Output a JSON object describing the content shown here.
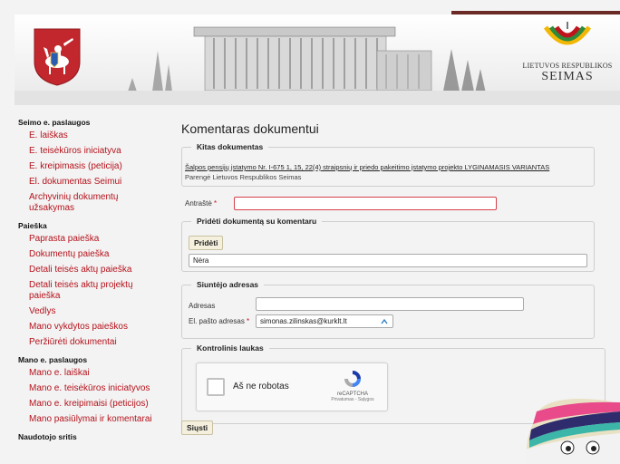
{
  "header": {
    "seimas_line1": "LIETUVOS RESPUBLIKOS",
    "seimas_line2": "SEIMAS"
  },
  "sidebar": {
    "sections": [
      {
        "title": "Seimo e. paslaugos",
        "items": [
          "E. laiškas",
          "E. teisėkūros iniciatyva",
          "E. kreipimasis (peticija)",
          "El. dokumentas Seimui",
          "Archyvinių dokumentų užsakymas"
        ]
      },
      {
        "title": "Paieška",
        "items": [
          "Paprasta paieška",
          "Dokumentų paieška",
          "Detali teisės aktų paieška",
          "Detali teisės aktų projektų paieška",
          "Vedlys",
          "Mano vykdytos paieškos",
          "Peržiūrėti dokumentai"
        ]
      },
      {
        "title": "Mano e. paslaugos",
        "items": [
          "Mano e. laiškai",
          "Mano e. teisėkūros iniciatyvos",
          "Mano e. kreipimaisi (peticijos)",
          "Mano pasiūlymai ir komentarai"
        ]
      },
      {
        "title": "Naudotojo sritis",
        "items": []
      }
    ]
  },
  "main": {
    "title": "Komentaras dokumentui",
    "other_docs": {
      "legend": "Kitas dokumentas",
      "link": "Šalpos pensijų įstatymo Nr. I-675 1, 15, 22(4) straipsnių ir priedo pakeitimo įstatymo projekto LYGINAMASIS VARIANTAS",
      "subtitle": "Parengė Lietuvos Respublikos Seimas"
    },
    "subject": {
      "label": "Antraštė",
      "required": "*",
      "value": ""
    },
    "attach": {
      "legend": "Pridėti dokumentą su komentaru",
      "button": "Pridėti",
      "value": "Nėra"
    },
    "sender": {
      "legend": "Siuntėjo adresas",
      "address_label": "Adresas",
      "address_value": "",
      "email_label": "El. pašto adresas",
      "required": "*",
      "email_value": "simonas.zilinskas@kurklt.lt"
    },
    "control": {
      "legend": "Kontrolinis laukas",
      "captcha_text": "Aš ne robotas",
      "captcha_brand": "reCAPTCHA",
      "captcha_links": "Privatumas - Sąlygos"
    },
    "send_button": "Siųsti"
  },
  "colors": {
    "link_red": "#b5121b",
    "header_maroon": "#6b2a25",
    "button_bg": "#f4f0dd"
  }
}
